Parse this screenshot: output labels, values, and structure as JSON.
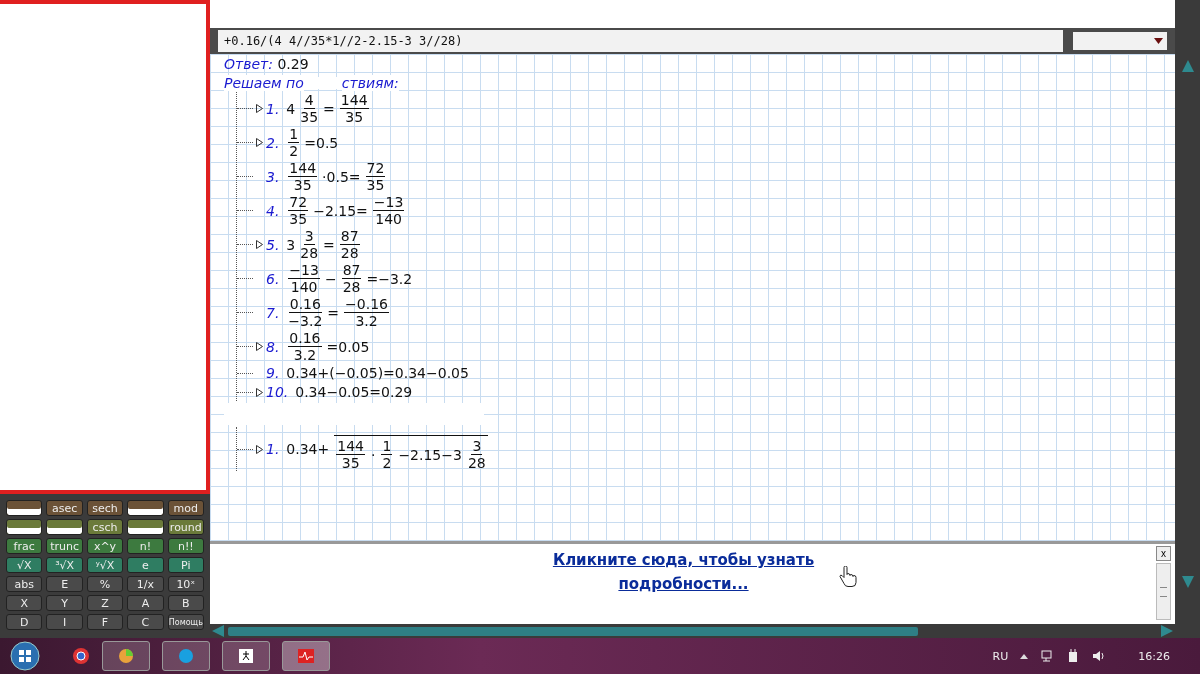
{
  "calculator": {
    "rows": [
      {
        "color": "#6b5237",
        "keys": [
          {
            "kind": "covered"
          },
          {
            "label": "asec"
          },
          {
            "label": "sech"
          },
          {
            "kind": "covered"
          },
          {
            "label": "mod"
          }
        ]
      },
      {
        "color": "#6b7a3a",
        "keys": [
          {
            "kind": "covered"
          },
          {
            "kind": "covered"
          },
          {
            "label": "csch"
          },
          {
            "kind": "covered"
          },
          {
            "label": "round"
          }
        ]
      },
      {
        "color": "#3d7a3f",
        "keys": [
          {
            "label": "frac"
          },
          {
            "label": "trunc"
          },
          {
            "label": "x^y"
          },
          {
            "label": "n!"
          },
          {
            "label": "n!!"
          }
        ]
      },
      {
        "color": "#2f7d62",
        "keys": [
          {
            "label": "√X"
          },
          {
            "label": "³√X"
          },
          {
            "label": "ʸ√X"
          },
          {
            "label": "e"
          },
          {
            "label": "Pi"
          }
        ]
      },
      {
        "color": "#4a4a4a",
        "keys": [
          {
            "label": "abs"
          },
          {
            "label": "E"
          },
          {
            "label": "%"
          },
          {
            "label": "1/x"
          },
          {
            "label": "10ˣ"
          }
        ]
      },
      {
        "color": "#4a4a4a",
        "keys": [
          {
            "label": "X"
          },
          {
            "label": "Y"
          },
          {
            "label": "Z"
          },
          {
            "label": "A"
          },
          {
            "label": "B"
          }
        ]
      },
      {
        "color": "#4a4a4a",
        "keys": [
          {
            "label": "D"
          },
          {
            "label": "I"
          },
          {
            "label": "F"
          },
          {
            "label": "C"
          },
          {
            "label": "Помощь"
          }
        ]
      }
    ]
  },
  "expression": {
    "value": "+0.16/(4 4//35*1//2-2.15-3 3//28)"
  },
  "answer": {
    "label": "Ответ:",
    "value": "0.29"
  },
  "heading": {
    "parts": [
      "Решаем по",
      "ствиям:"
    ]
  },
  "steps": [
    {
      "number": "1.",
      "expandable": true,
      "tokens": [
        {
          "kind": "text",
          "text": "4"
        },
        {
          "kind": "frac",
          "num": "4",
          "den": "35"
        },
        {
          "kind": "text",
          "text": "="
        },
        {
          "kind": "frac",
          "num": "144",
          "den": "35"
        }
      ]
    },
    {
      "number": "2.",
      "expandable": true,
      "tokens": [
        {
          "kind": "frac",
          "num": "1",
          "den": "2"
        },
        {
          "kind": "text",
          "text": "=0.5"
        }
      ]
    },
    {
      "number": "3.",
      "expandable": false,
      "tokens": [
        {
          "kind": "frac",
          "num": "144",
          "den": "35"
        },
        {
          "kind": "text",
          "text": "·0.5="
        },
        {
          "kind": "frac",
          "num": "72",
          "den": "35"
        }
      ]
    },
    {
      "number": "4.",
      "expandable": false,
      "tokens": [
        {
          "kind": "frac",
          "num": "72",
          "den": "35"
        },
        {
          "kind": "text",
          "text": "−2.15="
        },
        {
          "kind": "frac",
          "num": "−13",
          "den": "140"
        }
      ]
    },
    {
      "number": "5.",
      "expandable": true,
      "tokens": [
        {
          "kind": "text",
          "text": "3"
        },
        {
          "kind": "frac",
          "num": "3",
          "den": "28"
        },
        {
          "kind": "text",
          "text": "="
        },
        {
          "kind": "frac",
          "num": "87",
          "den": "28"
        }
      ]
    },
    {
      "number": "6.",
      "expandable": false,
      "tokens": [
        {
          "kind": "frac",
          "num": "−13",
          "den": "140"
        },
        {
          "kind": "text",
          "text": "−"
        },
        {
          "kind": "frac",
          "num": "87",
          "den": "28"
        },
        {
          "kind": "text",
          "text": "=−3.2"
        }
      ]
    },
    {
      "number": "7.",
      "expandable": false,
      "tokens": [
        {
          "kind": "frac",
          "num": "0.16",
          "den": "−3.2"
        },
        {
          "kind": "text",
          "text": "="
        },
        {
          "kind": "frac",
          "num": "−0.16",
          "den": "3.2"
        }
      ]
    },
    {
      "number": "8.",
      "expandable": true,
      "tokens": [
        {
          "kind": "frac",
          "num": "0.16",
          "den": "3.2"
        },
        {
          "kind": "text",
          "text": "=0.05"
        }
      ]
    },
    {
      "number": "9.",
      "expandable": false,
      "tokens": [
        {
          "kind": "text",
          "text": "0.34+(−0.05)=0.34−0.05"
        }
      ]
    },
    {
      "number": "10.",
      "expandable": true,
      "tokens": [
        {
          "kind": "text",
          "text": "0.34−0.05=0.29"
        }
      ]
    }
  ],
  "steps_2": [
    {
      "number": "1.",
      "expandable": true,
      "tokens": [
        {
          "kind": "text",
          "text": "0.34+"
        },
        {
          "kind": "bigfrac",
          "den": [
            {
              "kind": "frac",
              "num": "144",
              "den": "35"
            },
            {
              "kind": "text",
              "text": "·"
            },
            {
              "kind": "frac",
              "num": "1",
              "den": "2"
            },
            {
              "kind": "text",
              "text": "−2.15−3"
            },
            {
              "kind": "frac",
              "num": "3",
              "den": "28"
            }
          ]
        }
      ]
    }
  ],
  "notice": {
    "link": "Кликните сюда, чтобы узнать подробности...",
    "close": "x"
  },
  "taskbar": {
    "language": "RU",
    "time": "16:26"
  }
}
